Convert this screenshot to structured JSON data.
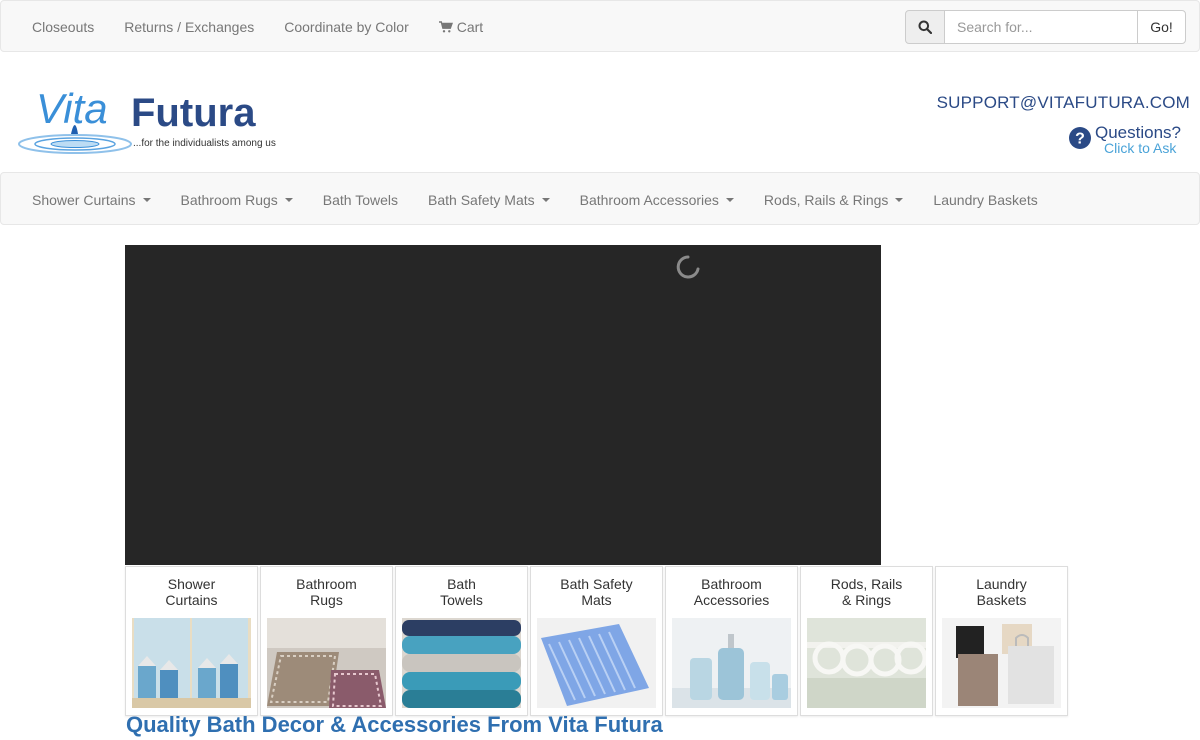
{
  "topnav": {
    "items": [
      {
        "label": "Closeouts"
      },
      {
        "label": "Returns / Exchanges"
      },
      {
        "label": "Coordinate by Color"
      },
      {
        "label": "Cart",
        "icon": "cart-icon"
      }
    ]
  },
  "search": {
    "placeholder": "Search for...",
    "value": "",
    "button_label": "Go!",
    "icon": "search-icon"
  },
  "brand": {
    "name_part1": "Vita",
    "name_part2": "Futura",
    "tagline": "...for the individualists among us",
    "colors": {
      "primary": "#2b4a86",
      "accent": "#3a8fd8"
    }
  },
  "contact": {
    "support_email": "SUPPORT@VITAFUTURA.COM",
    "questions_title": "Questions?",
    "questions_sub": "Click to Ask",
    "icon": "question-circle-icon"
  },
  "catnav": {
    "items": [
      {
        "label": "Shower Curtains",
        "dropdown": true
      },
      {
        "label": "Bathroom Rugs",
        "dropdown": true
      },
      {
        "label": "Bath Towels",
        "dropdown": false
      },
      {
        "label": "Bath Safety Mats",
        "dropdown": true
      },
      {
        "label": "Bathroom Accessories",
        "dropdown": true
      },
      {
        "label": "Rods, Rails & Rings",
        "dropdown": true
      },
      {
        "label": "Laundry Baskets",
        "dropdown": false
      }
    ]
  },
  "slider": {
    "state": "loading",
    "icon": "spinner-icon"
  },
  "tiles": [
    {
      "label": "Shower\nCurtains",
      "image": "shower-curtains-image"
    },
    {
      "label": "Bathroom\nRugs",
      "image": "bathroom-rugs-image"
    },
    {
      "label": "Bath\nTowels",
      "image": "bath-towels-image"
    },
    {
      "label": "Bath Safety\nMats",
      "image": "bath-safety-mats-image"
    },
    {
      "label": "Bathroom\nAccessories",
      "image": "bathroom-accessories-image"
    },
    {
      "label": "Rods, Rails\n& Rings",
      "image": "rods-rails-rings-image"
    },
    {
      "label": "Laundry\nBaskets",
      "image": "laundry-baskets-image"
    }
  ],
  "main": {
    "heading": "Quality Bath Decor & Accessories From Vita Futura"
  }
}
